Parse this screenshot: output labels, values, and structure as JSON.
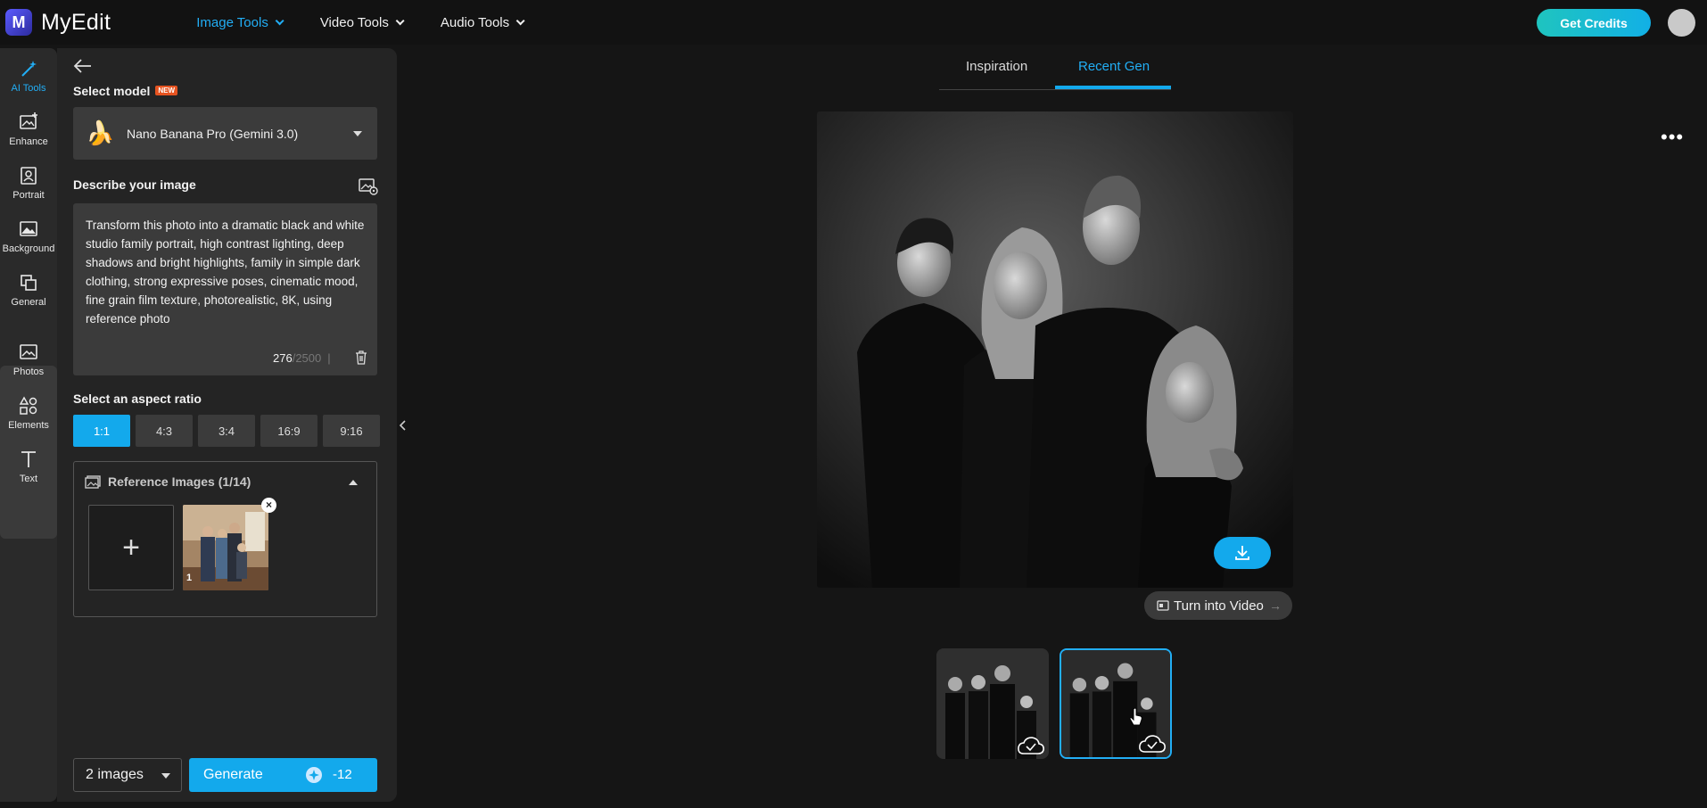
{
  "app": {
    "name": "MyEdit"
  },
  "nav": {
    "items": [
      "Image Tools",
      "Video Tools",
      "Audio Tools"
    ],
    "active": "Image Tools"
  },
  "header": {
    "credits_button": "Get Credits"
  },
  "rail": {
    "items": [
      {
        "label": "AI Tools",
        "icon": "magic-wand-icon"
      },
      {
        "label": "Enhance",
        "icon": "enhance-icon"
      },
      {
        "label": "Portrait",
        "icon": "portrait-icon"
      },
      {
        "label": "Background",
        "icon": "background-icon"
      },
      {
        "label": "General",
        "icon": "general-icon"
      },
      {
        "label": "Photos",
        "icon": "photo-icon"
      },
      {
        "label": "Elements",
        "icon": "elements-icon"
      },
      {
        "label": "Text",
        "icon": "text-icon"
      }
    ],
    "group_plus": "+"
  },
  "panel": {
    "model_label": "Select model",
    "model_badge": "NEW",
    "model_value": "Nano Banana Pro (Gemini 3.0)",
    "describe_label": "Describe your image",
    "prompt": "Transform this photo into a dramatic black and white studio family portrait, high contrast lighting, deep shadows and bright highlights, family in simple dark clothing, strong expressive poses, cinematic mood, fine grain film texture, photorealistic, 8K, using reference photo",
    "char_count": "276",
    "char_max": "/2500",
    "aspect_label": "Select an aspect ratio",
    "aspect_ratios": [
      "1:1",
      "4:3",
      "3:4",
      "16:9",
      "9:16"
    ],
    "aspect_selected": "1:1",
    "reference_label": "Reference Images (1/14)",
    "reference_index": "1",
    "image_count": "2 images",
    "generate_label": "Generate",
    "generate_cost": "-12"
  },
  "main": {
    "tabs": [
      "Inspiration",
      "Recent Gen"
    ],
    "active_tab": "Recent Gen",
    "turn_into_video": "Turn into Video",
    "thumbnails_count": 2,
    "selected_thumbnail": 2
  },
  "colors": {
    "accent": "#13a9ec",
    "credits_gradient": [
      "#1fc4bf",
      "#12b0e6"
    ],
    "new_badge": "#e65320"
  }
}
